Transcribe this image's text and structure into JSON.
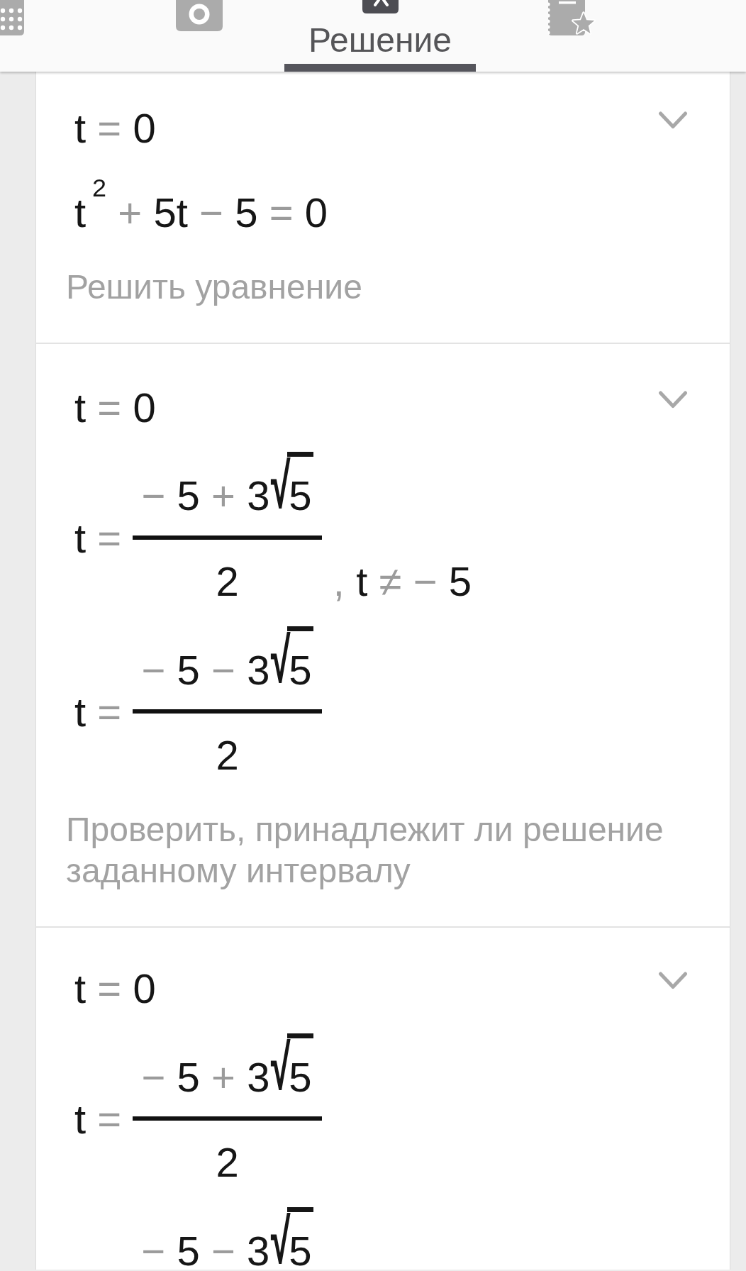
{
  "tabs": [
    {
      "kind": "calculator",
      "selected": false
    },
    {
      "kind": "camera",
      "selected": false
    },
    {
      "kind": "solution",
      "label": "Решение",
      "selected": true
    },
    {
      "kind": "bookmarks",
      "selected": false
    }
  ],
  "steps": [
    {
      "expanded": false,
      "lines": [
        {
          "kind": "equation",
          "tokens": [
            {
              "kind": "term",
              "text": "t"
            },
            {
              "kind": "op",
              "text": "="
            },
            {
              "kind": "term",
              "text": "0"
            }
          ]
        },
        {
          "kind": "equation",
          "tokens": [
            {
              "kind": "term",
              "text": "t$^{2}$"
            },
            {
              "kind": "op",
              "text": "+"
            },
            {
              "kind": "term",
              "text": "5t"
            },
            {
              "kind": "op",
              "text": "−"
            },
            {
              "kind": "term",
              "text": "5"
            },
            {
              "kind": "op",
              "text": "="
            },
            {
              "kind": "term",
              "text": "0"
            }
          ]
        }
      ],
      "description": "Решить уравнение"
    },
    {
      "expanded": false,
      "lines": [
        {
          "kind": "equation",
          "tokens": [
            {
              "kind": "term",
              "text": "t"
            },
            {
              "kind": "op",
              "text": "="
            },
            {
              "kind": "term",
              "text": "0"
            }
          ]
        },
        {
          "kind": "fraction",
          "lhs": [
            {
              "kind": "term",
              "text": "t"
            },
            {
              "kind": "op",
              "text": "="
            }
          ],
          "numerator": [
            {
              "kind": "op",
              "text": "−"
            },
            {
              "kind": "term",
              "text": "5"
            },
            {
              "kind": "op",
              "text": "+"
            },
            {
              "kind": "term",
              "text": "3"
            },
            {
              "kind": "radical",
              "text": "√"
            },
            {
              "kind": "radicand",
              "text": "5"
            }
          ],
          "denominator": [
            {
              "kind": "term",
              "text": "2"
            }
          ],
          "suffix": [
            {
              "kind": "op",
              "text": ","
            },
            {
              "kind": "term",
              "text": "t"
            },
            {
              "kind": "op",
              "text": "≠"
            },
            {
              "kind": "op",
              "text": "−"
            },
            {
              "kind": "term",
              "text": "5"
            }
          ]
        },
        {
          "kind": "fraction",
          "lhs": [
            {
              "kind": "term",
              "text": "t"
            },
            {
              "kind": "op",
              "text": "="
            }
          ],
          "numerator": [
            {
              "kind": "op",
              "text": "−"
            },
            {
              "kind": "term",
              "text": "5"
            },
            {
              "kind": "op",
              "text": "−"
            },
            {
              "kind": "term",
              "text": "3"
            },
            {
              "kind": "radical",
              "text": "√"
            },
            {
              "kind": "radicand",
              "text": "5"
            }
          ],
          "denominator": [
            {
              "kind": "term",
              "text": "2"
            }
          ]
        }
      ],
      "description": "Проверить, принадлежит ли решение заданному интервалу"
    },
    {
      "expanded": false,
      "lines": [
        {
          "kind": "equation",
          "tokens": [
            {
              "kind": "term",
              "text": "t"
            },
            {
              "kind": "op",
              "text": "="
            },
            {
              "kind": "term",
              "text": "0"
            }
          ]
        },
        {
          "kind": "fraction",
          "lhs": [
            {
              "kind": "term",
              "text": "t"
            },
            {
              "kind": "op",
              "text": "="
            }
          ],
          "numerator": [
            {
              "kind": "op",
              "text": "−"
            },
            {
              "kind": "term",
              "text": "5"
            },
            {
              "kind": "op",
              "text": "+"
            },
            {
              "kind": "term",
              "text": "3"
            },
            {
              "kind": "radical",
              "text": "√"
            },
            {
              "kind": "radicand",
              "text": "5"
            }
          ],
          "denominator": [
            {
              "kind": "term",
              "text": "2"
            }
          ]
        },
        {
          "kind": "fraction",
          "numerator": [
            {
              "kind": "op",
              "text": "−"
            },
            {
              "kind": "term",
              "text": "5"
            },
            {
              "kind": "op",
              "text": "−"
            },
            {
              "kind": "term",
              "text": "3"
            },
            {
              "kind": "radical",
              "text": "√"
            },
            {
              "kind": "radicand",
              "text": "5"
            }
          ]
        }
      ]
    }
  ]
}
